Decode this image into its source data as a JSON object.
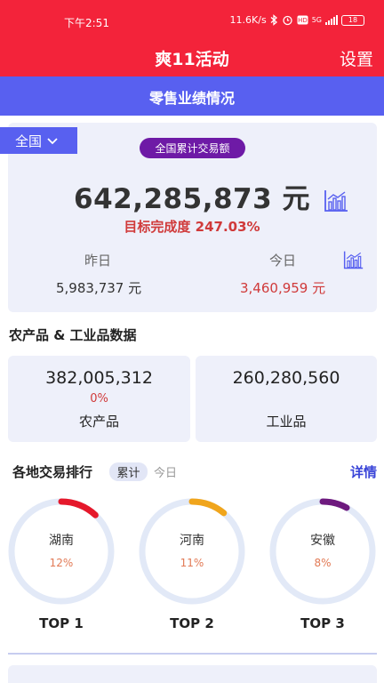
{
  "status_bar": {
    "time": "下午2:51",
    "speed": "11.6K/s",
    "network": "5G",
    "battery": "18"
  },
  "app_bar": {
    "title": "爽11活动",
    "settings_label": "设置"
  },
  "sub_bar": {
    "title": "零售业绩情况"
  },
  "overview": {
    "region": "全国",
    "pill_label": "全国累计交易额",
    "total_amount": "642,285,873 元",
    "goal_label": "目标完成度",
    "goal_value": "247.03%",
    "yesterday_label": "昨日",
    "yesterday_value": "5,983,737 元",
    "today_label": "今日",
    "today_value": "3,460,959 元"
  },
  "categories": {
    "section_title": "农产品 & 工业品数据",
    "agri_value": "382,005,312",
    "agri_pct": "0%",
    "agri_label": "农产品",
    "industrial_value": "260,280,560",
    "industrial_label": "工业品"
  },
  "ranking": {
    "title": "各地交易排行",
    "tab_cumulative": "累计",
    "tab_today": "今日",
    "detail_label": "详情",
    "items": [
      {
        "name": "湖南",
        "pct": "12%",
        "pct_value": 12,
        "rank": "TOP 1",
        "color": "#e5182b"
      },
      {
        "name": "河南",
        "pct": "11%",
        "pct_value": 11,
        "rank": "TOP 2",
        "color": "#f0a51c"
      },
      {
        "name": "安徽",
        "pct": "8%",
        "pct_value": 8,
        "rank": "TOP 3",
        "color": "#6e1a7e"
      }
    ]
  },
  "colors": {
    "header_red": "#f3233a",
    "accent_blue": "#5860f0",
    "purple_pill": "#6e1aa6",
    "highlight_red": "#d03a3a",
    "card_bg": "#eef0fa",
    "ring_track": "#e2e9f7"
  }
}
